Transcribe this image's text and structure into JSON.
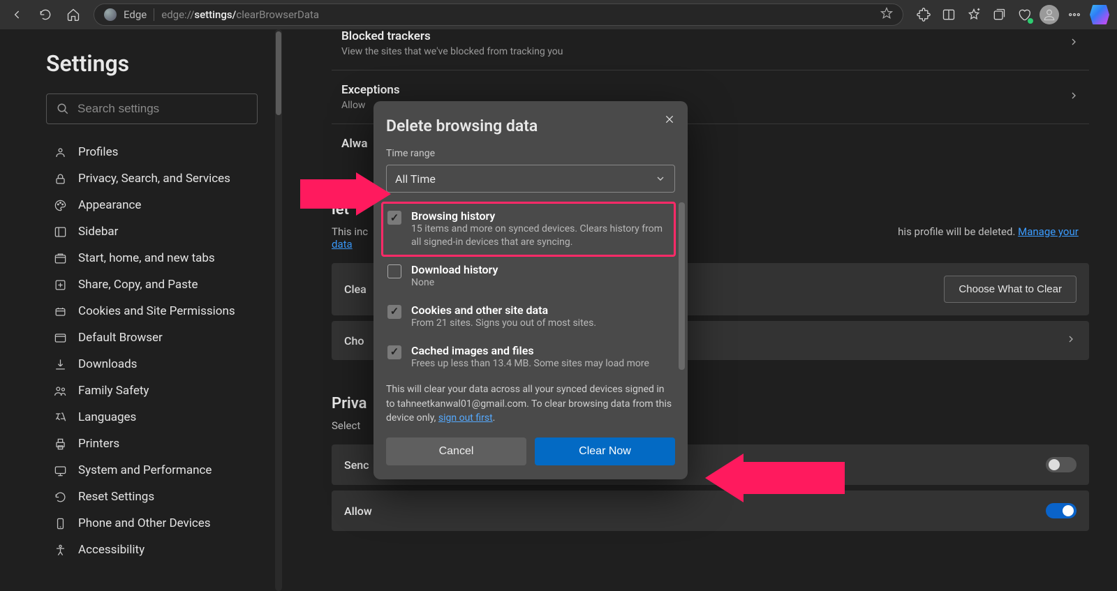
{
  "toolbar": {
    "browser_name": "Edge",
    "url_prefix": "edge://",
    "url_mid": "settings/",
    "url_bold": "clearBrowserData"
  },
  "sidebar": {
    "title": "Settings",
    "search_placeholder": "Search settings",
    "items": [
      {
        "label": "Profiles",
        "icon": "profile-icon"
      },
      {
        "label": "Privacy, Search, and Services",
        "icon": "lock-icon"
      },
      {
        "label": "Appearance",
        "icon": "palette-icon"
      },
      {
        "label": "Sidebar",
        "icon": "sidebar-icon"
      },
      {
        "label": "Start, home, and new tabs",
        "icon": "tabs-icon"
      },
      {
        "label": "Share, Copy, and Paste",
        "icon": "share-icon"
      },
      {
        "label": "Cookies and Site Permissions",
        "icon": "cookie-icon"
      },
      {
        "label": "Default Browser",
        "icon": "browser-icon"
      },
      {
        "label": "Downloads",
        "icon": "download-icon"
      },
      {
        "label": "Family Safety",
        "icon": "family-icon"
      },
      {
        "label": "Languages",
        "icon": "language-icon"
      },
      {
        "label": "Printers",
        "icon": "printer-icon"
      },
      {
        "label": "System and Performance",
        "icon": "system-icon"
      },
      {
        "label": "Reset Settings",
        "icon": "reset-icon"
      },
      {
        "label": "Phone and Other Devices",
        "icon": "phone-icon"
      },
      {
        "label": "Accessibility",
        "icon": "accessibility-icon"
      }
    ]
  },
  "content": {
    "blocked": {
      "title": "Blocked trackers",
      "sub": "View the sites that we've blocked from tracking you"
    },
    "exceptions": {
      "title": "Exceptions",
      "sub": "Allow"
    },
    "always": {
      "title": "Alwa"
    },
    "delete_heading_vis": "let",
    "delete_desc_pre": "This inc",
    "delete_desc_post": "his profile will be deleted. ",
    "delete_desc_link": "Manage your data",
    "row_clear": "Clea",
    "row_choose": "Cho",
    "row_choose_btn": "Choose What to Clear",
    "privacy_title": "Priva",
    "privacy_sub": "Select ",
    "row_send": "Senc",
    "row_allow": "Allow"
  },
  "modal": {
    "title": "Delete browsing data",
    "time_label": "Time range",
    "time_value": "All Time",
    "options": [
      {
        "title": "Browsing history",
        "sub": "15 items and more on synced devices. Clears history from all signed-in devices that are syncing.",
        "checked": true,
        "highlight": true
      },
      {
        "title": "Download history",
        "sub": "None",
        "checked": false,
        "highlight": false
      },
      {
        "title": "Cookies and other site data",
        "sub": "From 21 sites. Signs you out of most sites.",
        "checked": true,
        "highlight": false
      },
      {
        "title": "Cached images and files",
        "sub": "Frees up less than 13.4 MB. Some sites may load more",
        "checked": true,
        "highlight": false
      }
    ],
    "note_pre": "This will clear your data across all your synced devices signed in to tahneetkanwal01@gmail.com. To clear browsing data from this device only, ",
    "note_link": "sign out first",
    "note_post": ".",
    "cancel": "Cancel",
    "clear": "Clear Now"
  }
}
